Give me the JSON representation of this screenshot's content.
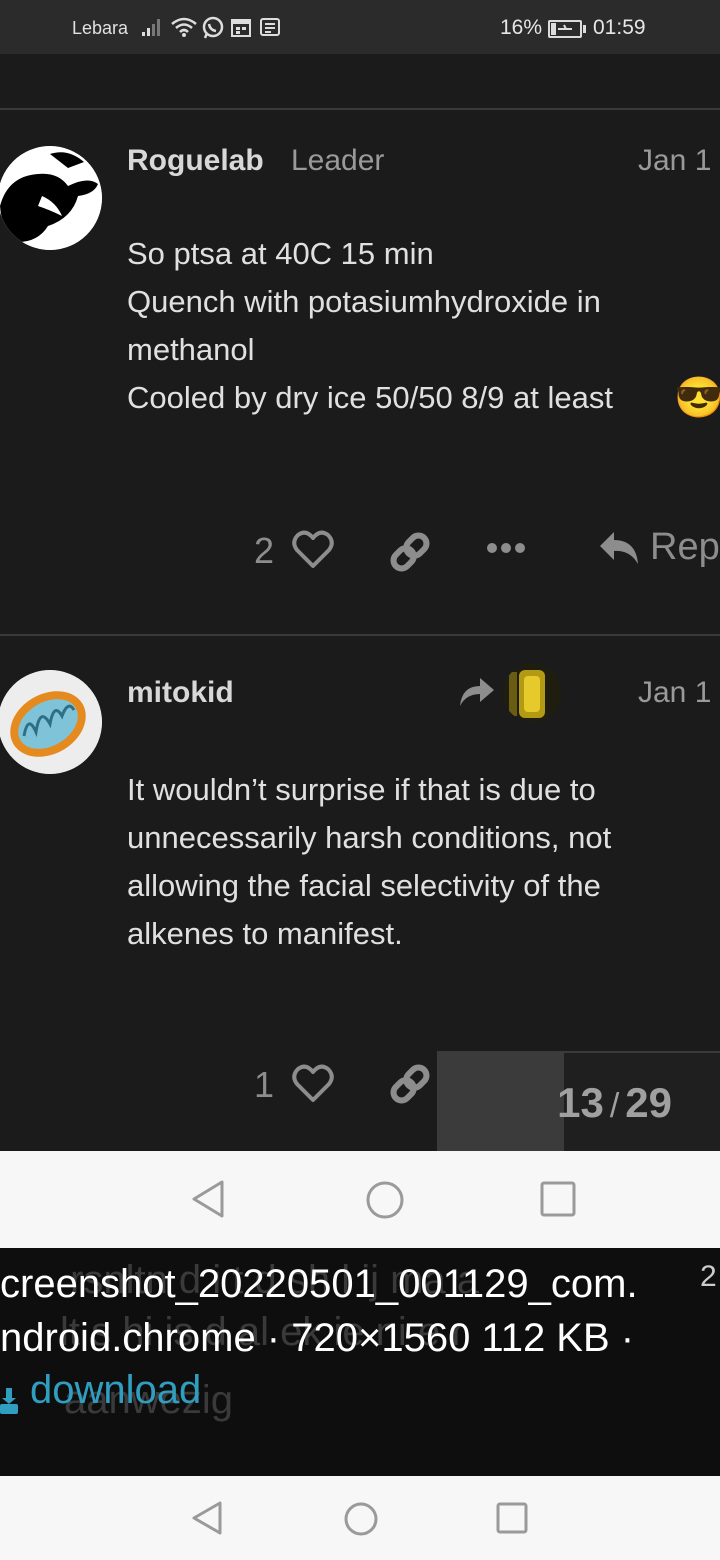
{
  "status_bar": {
    "carrier": "Lebara",
    "battery_percent": "16%",
    "time": "01:59",
    "icons": [
      "signal-icon",
      "wifi-icon",
      "whatsapp-icon",
      "calendar-icon",
      "notification-icon",
      "battery-charging-icon"
    ]
  },
  "posts": [
    {
      "username": "Roguelab",
      "role": "Leader",
      "date": "Jan 1",
      "body": "So ptsa at 40C 15 min\nQuench with potasiumhydroxide in\nmethanol\nCooled by dry ice 50/50 8/9 at least",
      "emoji": "😎",
      "likes": "2",
      "reply_label": "Rep"
    },
    {
      "username": "mitokid",
      "date": "Jan 1",
      "body": "It wouldn’t surprise if that is due to\nunnecessarily harsh conditions, not\nallowing the facial selectivity of the\nalkenes to manifest.",
      "likes": "1"
    }
  ],
  "progress": {
    "current": "13",
    "total": "29",
    "fraction": 0.448
  },
  "overlay": {
    "line1": "creenshot_20220501_001129_com.",
    "line1_suffix": "2",
    "line2": "ndroid.chrome · 720×1560 112 KB ·",
    "download": "download",
    "ghost1": "rsnltn   d  i  t   d  sh  l    ij   ma  a",
    "ghost2": "lt  s hi  is   d  al  ek   ie   ni  e  r",
    "ghost3": "aanwezig"
  }
}
